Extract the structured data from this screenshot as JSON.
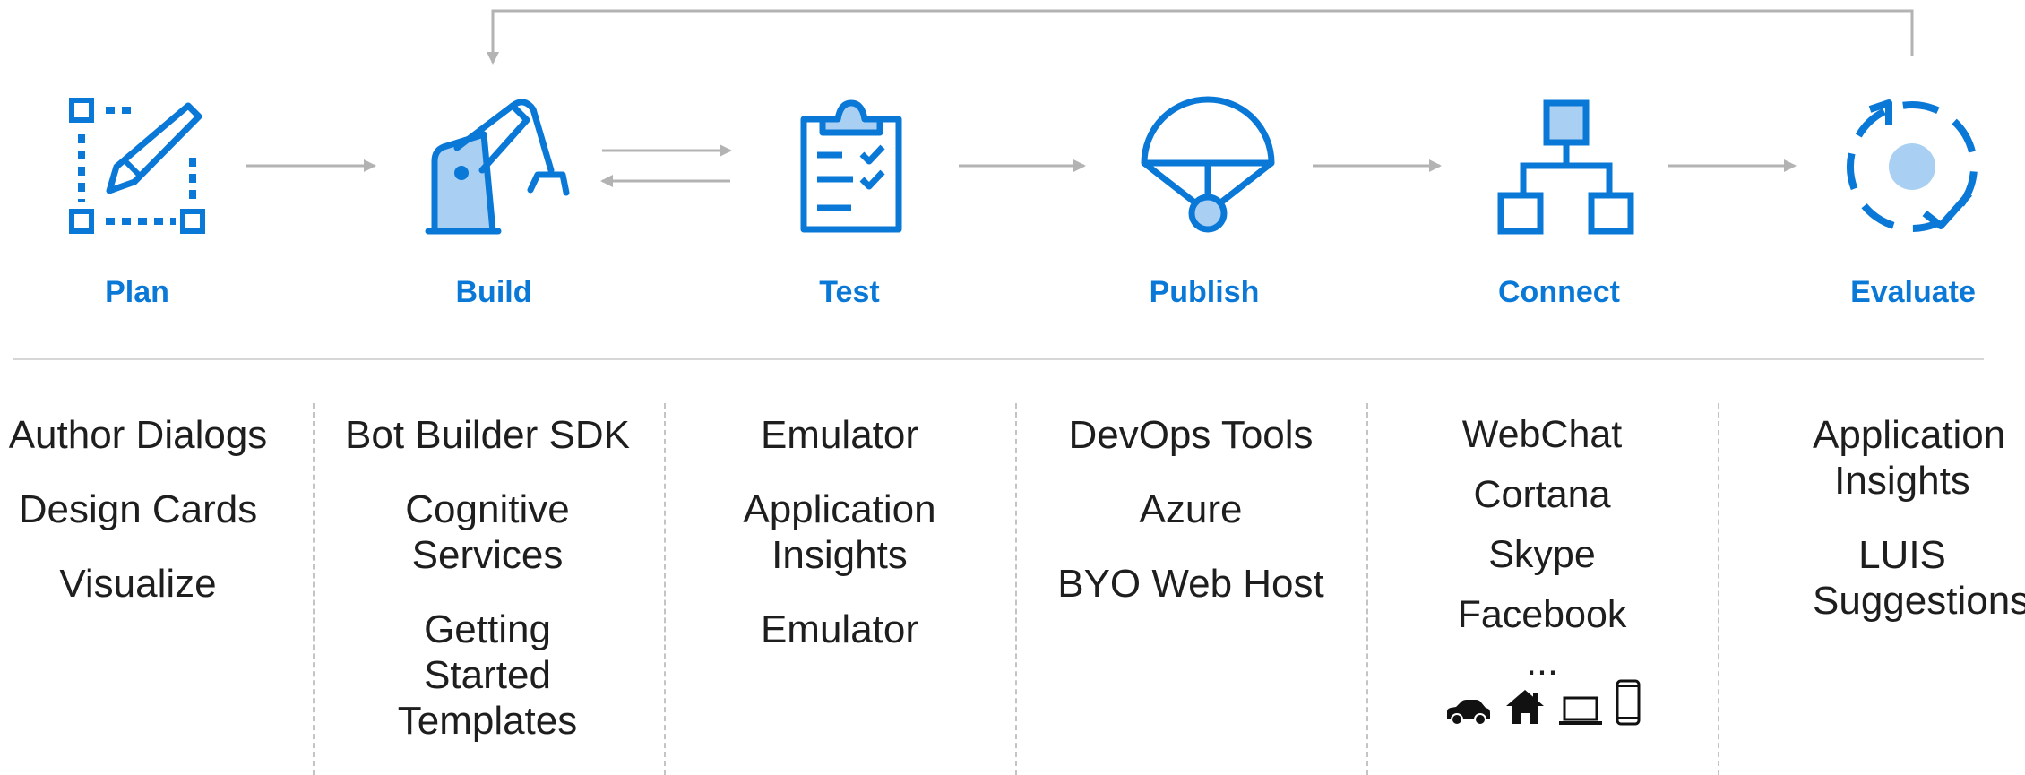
{
  "colors": {
    "accent": "#0a78d7",
    "accent_fill": "#a9d0f3",
    "arrow": "#b3b3b3",
    "text": "#1e1e1e",
    "divider": "#c4c4c4"
  },
  "stages": [
    {
      "label": "Plan",
      "icon": "edit-select-icon"
    },
    {
      "label": "Build",
      "icon": "robot-arm-icon"
    },
    {
      "label": "Test",
      "icon": "clipboard-checklist-icon"
    },
    {
      "label": "Publish",
      "icon": "parachute-icon"
    },
    {
      "label": "Connect",
      "icon": "network-hierarchy-icon"
    },
    {
      "label": "Evaluate",
      "icon": "refresh-check-icon"
    }
  ],
  "columns": [
    {
      "items": [
        "Author Dialogs",
        "Design Cards",
        "Visualize"
      ]
    },
    {
      "items": [
        "Bot Builder SDK",
        "Cognitive Services",
        "Getting Started Templates"
      ]
    },
    {
      "items": [
        "Emulator",
        "Application Insights",
        "Emulator"
      ]
    },
    {
      "items": [
        "DevOps Tools",
        "Azure",
        "BYO Web Host"
      ]
    },
    {
      "items": [
        "WebChat",
        "Cortana",
        "Skype",
        "Facebook",
        "..."
      ],
      "devices": [
        "car-icon",
        "home-icon",
        "laptop-icon",
        "phone-icon"
      ]
    },
    {
      "items": [
        "Application Insights",
        "LUIS Suggestions"
      ]
    }
  ]
}
